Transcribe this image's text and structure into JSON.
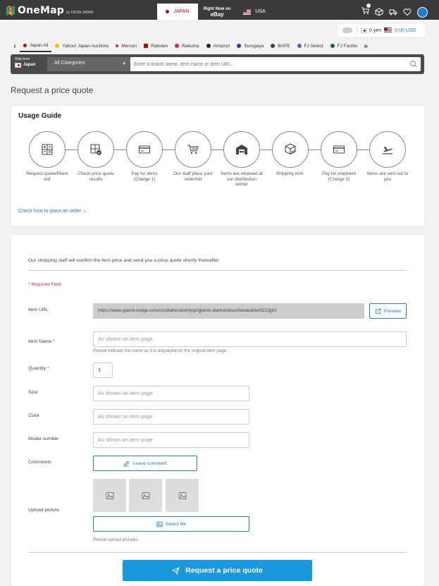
{
  "header": {
    "brand": "OneMap",
    "brand_by": "by FROM JAPAN",
    "region_tabs": [
      {
        "label": "JAPAN"
      },
      {
        "label_top": "Right Now on",
        "label_main": "eBay"
      },
      {
        "label": "USA"
      }
    ]
  },
  "balance": {
    "yen": "0 yen",
    "usd": "0.00 USD"
  },
  "site_tabs": [
    {
      "label": "Japan All",
      "color": "#d40000"
    },
    {
      "label": "Yahoo! Japan Auctions",
      "color": "#f2c200"
    },
    {
      "label": "Mercari",
      "color": "#e23"
    },
    {
      "label": "Rakuten",
      "color": "#bf0000"
    },
    {
      "label": "Rakuma",
      "color": "#e23"
    },
    {
      "label": "Amazon",
      "color": "#222"
    },
    {
      "label": "Surugaya",
      "color": "#2140a0"
    },
    {
      "label": "BAPE",
      "color": "#5a3a1a"
    },
    {
      "label": "FJ Select",
      "color": "#6a5ac8"
    },
    {
      "label": "FJ Fashio",
      "color": "#1d5a4a"
    }
  ],
  "search": {
    "ship_from_label": "Ship from",
    "ship_from_country": "Japan",
    "category": "All Categories",
    "placeholder": "Enter a brand name, item name or item URL."
  },
  "page_title": "Request a price quote",
  "guide": {
    "title": "Usage Guide",
    "steps": [
      {
        "label": "Request quote/Place bid",
        "icon": "calculator-icon"
      },
      {
        "label": "Check price quote results",
        "icon": "calculator-check-icon"
      },
      {
        "label": "Pay for items (Charge 1)",
        "icon": "credit-card-icon"
      },
      {
        "label": "Our staff place your order/bid",
        "icon": "cart-icon"
      },
      {
        "label": "Items are received at our distribution center",
        "icon": "warehouse-icon"
      },
      {
        "label": "Shipping instr.",
        "icon": "box-check-icon"
      },
      {
        "label": "Pay for shipment (Charge 2)",
        "icon": "credit-card-icon"
      },
      {
        "label": "Items are sent out to you",
        "icon": "plane-icon"
      }
    ],
    "check_link": "Check how to place an order"
  },
  "form": {
    "intro": "Our shopping staff will confirm the item price and send you a price quote shortly thereafter.",
    "required_note": "* Required Field",
    "item_url_label": "Item URL",
    "item_url_value": "https://www.glamb-lodge.com/c/collaboration/jojo/glamb-diamondisunbreakable/0223jj01",
    "preview_label": "Preview",
    "item_name_label": "Item Name",
    "item_name_placeholder": "As shown on item page",
    "item_name_hint": "Please indicate the name as it is displayed on the original item page.",
    "quantity_label": "Quantity",
    "quantity_value": "1",
    "size_label": "Size",
    "size_placeholder": "As shown on item page",
    "color_label": "Color",
    "color_placeholder": "As shown on item page",
    "model_label": "Model number",
    "model_placeholder": "As shown on item page",
    "comments_label": "Comments",
    "leave_comment": "Leave comment",
    "upload_label": "Upload picture",
    "select_file": "Select file",
    "upload_hint": "Please upload pictures",
    "submit_label": "Request a price quote"
  },
  "colors": {
    "accent": "#1e7fd0",
    "submit": "#1a98db",
    "required": "#e23",
    "topbar": "#3a3a3a"
  }
}
